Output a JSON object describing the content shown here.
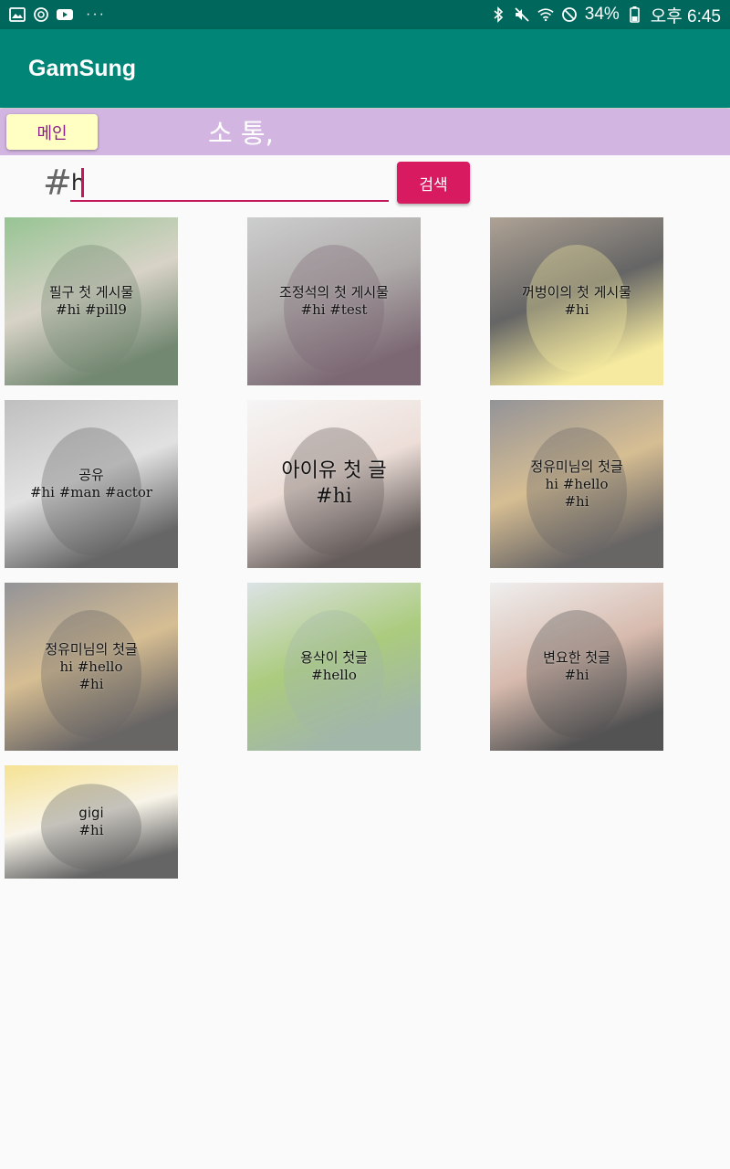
{
  "status_bar": {
    "battery": "34%",
    "time": "오후 6:45",
    "dots": "···",
    "icons_left": [
      "image-icon",
      "sync-icon",
      "youtube-icon"
    ],
    "icons_right": [
      "bluetooth-icon",
      "mute-icon",
      "wifi-icon",
      "blocked-icon",
      "battery-icon"
    ]
  },
  "app_bar": {
    "title": "GamSung"
  },
  "menu": {
    "main_button": "메인",
    "title": "소 통,"
  },
  "search": {
    "hash": "#",
    "value": "h",
    "button": "검색"
  },
  "posts": [
    {
      "title": "필구 첫 게시물",
      "tags": "#hi #pill9",
      "colors": [
        "#6fae6a",
        "#3c5a3a",
        "#c9c2b2"
      ]
    },
    {
      "title": "조정석의 첫 게시물",
      "tags": "#hi #test",
      "colors": [
        "#b9bbbb",
        "#4a2f3e",
        "#8f8a88"
      ]
    },
    {
      "title": "꺼벙이의 첫 게시물",
      "tags": "#hi",
      "colors": [
        "#8f7f6c",
        "#f2e27a",
        "#2a2a2a"
      ]
    },
    {
      "title": "공유",
      "tags": "#hi #man #actor",
      "colors": [
        "#a7a7a7",
        "#2b2b2b",
        "#d6d6d6"
      ]
    },
    {
      "title": "아이유 첫 글",
      "tags": "#hi",
      "colors": [
        "#f2f2f2",
        "#2a1f1c",
        "#e6d2c9"
      ]
    },
    {
      "title": "정유미님의 첫글",
      "tags": "hi #hello",
      "tags2": "#hi",
      "colors": [
        "#6a6a70",
        "#2e2a2a",
        "#c7a56a"
      ]
    },
    {
      "title": "정유미님의 첫글",
      "tags": "hi #hello",
      "tags2": "#hi",
      "colors": [
        "#6a6a70",
        "#2e2a2a",
        "#c7a56a"
      ]
    },
    {
      "title": "용삭이 첫글",
      "tags": "#hello",
      "colors": [
        "#cfd8dc",
        "#7f9a8a",
        "#8bb84c"
      ]
    },
    {
      "title": "변요한 첫글",
      "tags": "#hi",
      "colors": [
        "#e9e9e9",
        "#111111",
        "#c8a08e"
      ]
    },
    {
      "title": "gigi",
      "tags": "#hi",
      "colors": [
        "#f3d86b",
        "#2a2a2a",
        "#f5f0e0"
      ]
    }
  ]
}
